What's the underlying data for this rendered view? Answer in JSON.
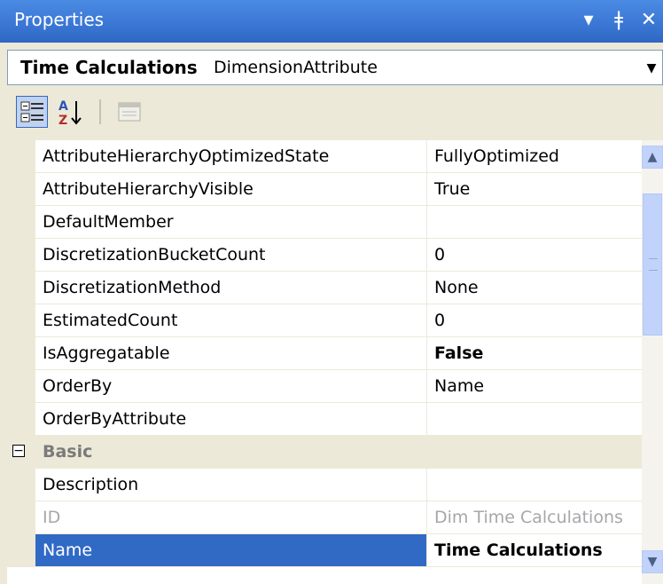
{
  "window": {
    "title": "Properties",
    "buttons": [
      "▾",
      " Ʈ",
      "✕"
    ]
  },
  "object": {
    "name": "Time Calculations",
    "type": "DimensionAttribute"
  },
  "toolbar": {
    "categorized_icon": "categorized-icon",
    "alphabetical_icon": "alphabetical-icon",
    "property_pages_icon": "property-pages-icon"
  },
  "properties": [
    {
      "name": "AttributeHierarchyOptimizedState",
      "value": "FullyOptimized"
    },
    {
      "name": "AttributeHierarchyVisible",
      "value": "True"
    },
    {
      "name": "DefaultMember",
      "value": ""
    },
    {
      "name": "DiscretizationBucketCount",
      "value": "0"
    },
    {
      "name": "DiscretizationMethod",
      "value": "None"
    },
    {
      "name": "EstimatedCount",
      "value": "0"
    },
    {
      "name": "IsAggregatable",
      "value": "False"
    },
    {
      "name": "OrderBy",
      "value": "Name"
    },
    {
      "name": "OrderByAttribute",
      "value": ""
    }
  ],
  "category": {
    "toggle": "⊟",
    "label": "Basic"
  },
  "basic_properties": [
    {
      "name": "Description",
      "value": ""
    },
    {
      "name": "ID",
      "value": "Dim Time Calculations"
    },
    {
      "name": "Name",
      "value": "Time Calculations"
    }
  ]
}
